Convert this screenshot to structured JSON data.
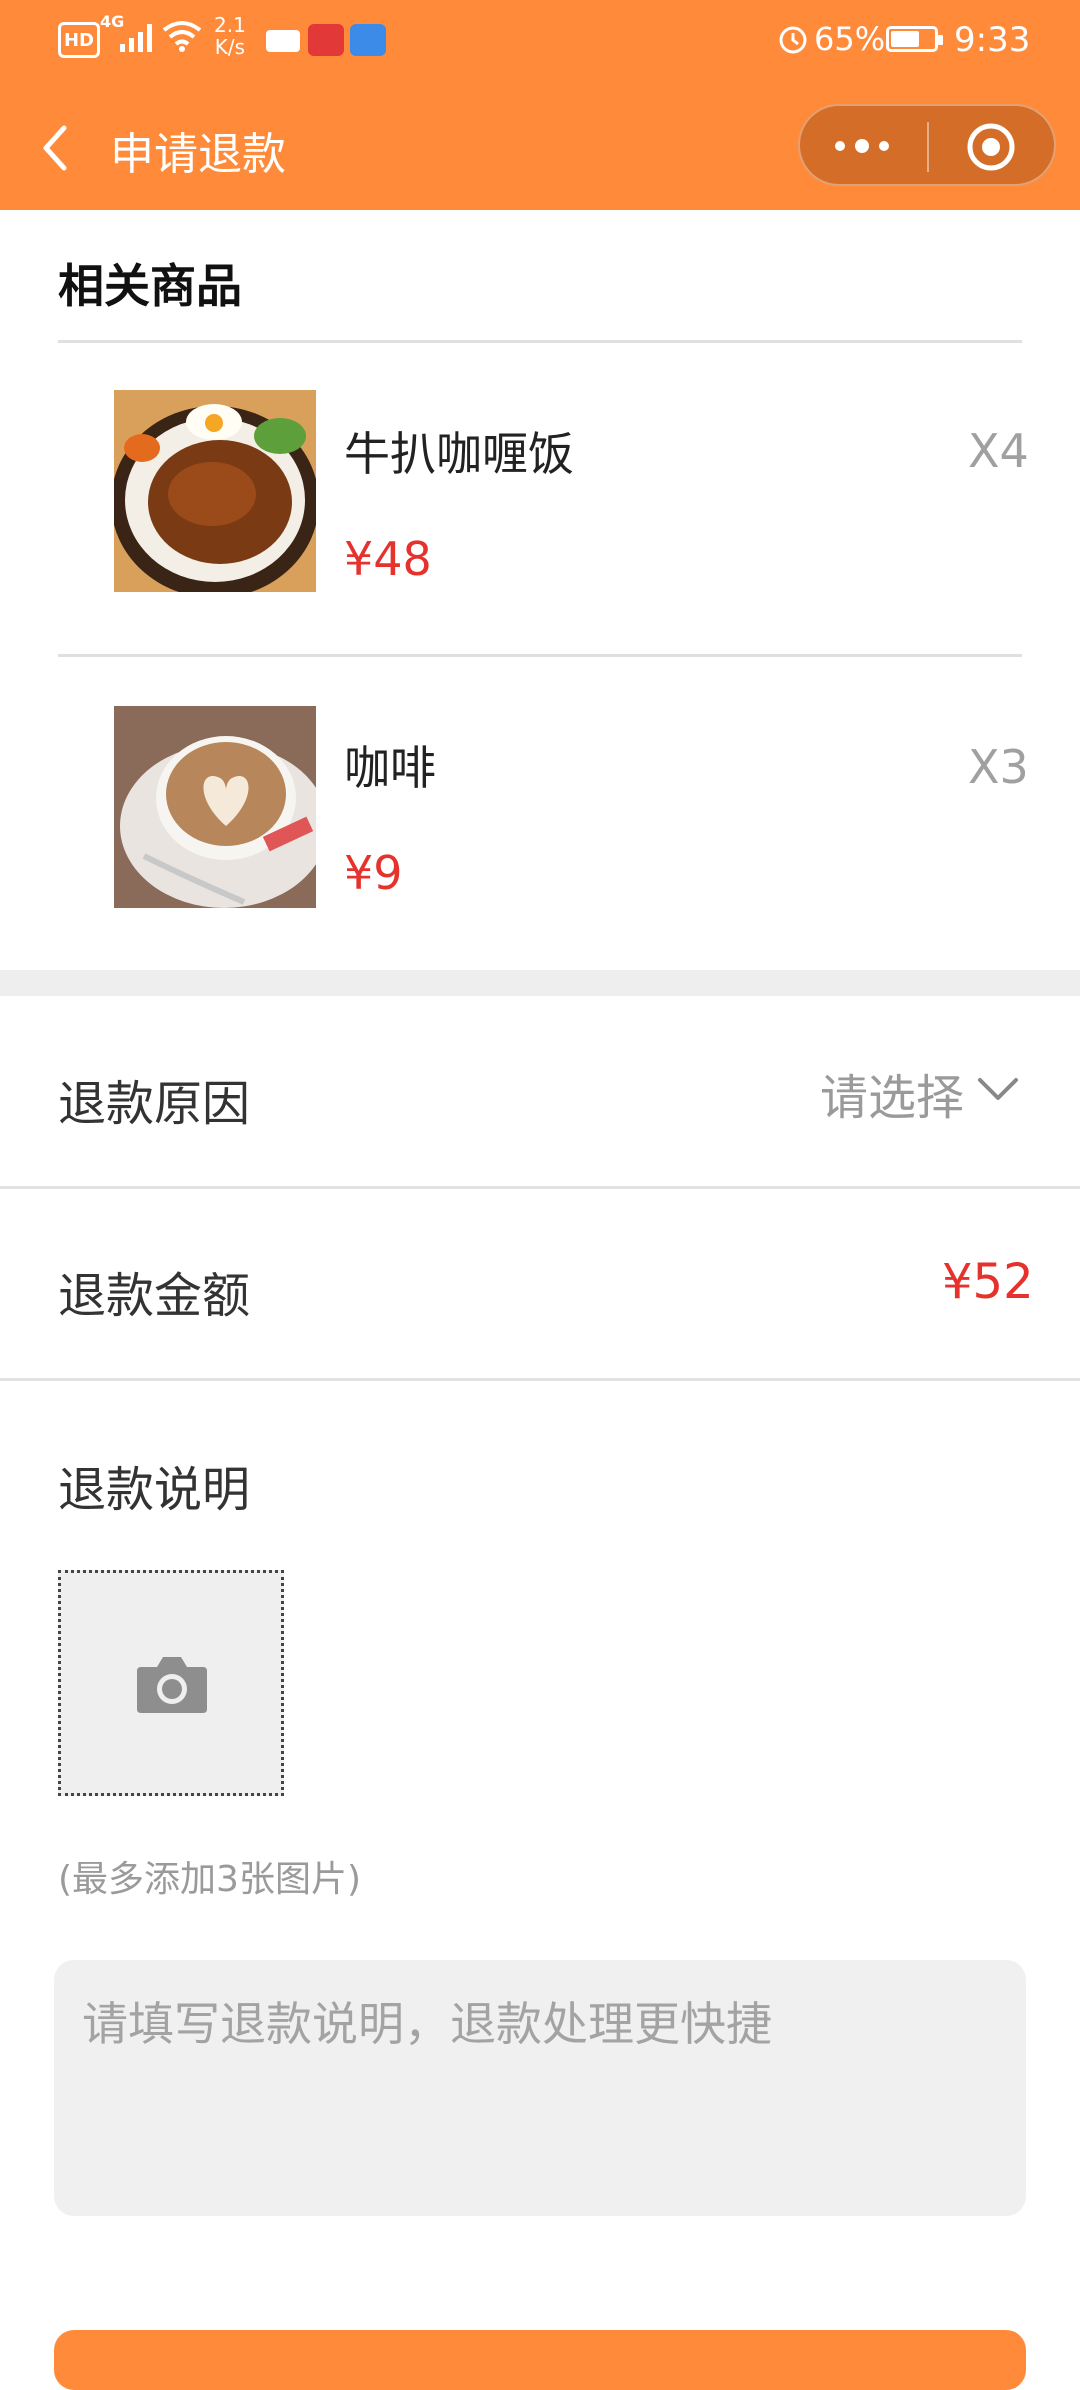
{
  "status_bar": {
    "hd": "HD",
    "network": "4G",
    "speed_value": "2.1",
    "speed_unit": "K/s",
    "battery": "65%",
    "time": "9:33"
  },
  "header": {
    "title": "申请退款"
  },
  "products_section": {
    "title": "相关商品",
    "items": [
      {
        "name": "牛扒咖喱饭",
        "price": "¥48",
        "qty": "X4"
      },
      {
        "name": "咖啡",
        "price": "¥9",
        "qty": "X3"
      }
    ]
  },
  "refund": {
    "reason_label": "退款原因",
    "reason_value": "请选择",
    "amount_label": "退款金额",
    "amount_value": "¥52",
    "desc_label": "退款说明",
    "photo_hint": "(最多添加3张图片)",
    "desc_placeholder": "请填写退款说明，退款处理更快捷"
  },
  "colors": {
    "brand": "#ff8a3a",
    "price": "#e5322d"
  },
  "icons": [
    "back-arrow-icon",
    "more-dots-icon",
    "target-icon",
    "chevron-down-icon",
    "camera-icon"
  ]
}
